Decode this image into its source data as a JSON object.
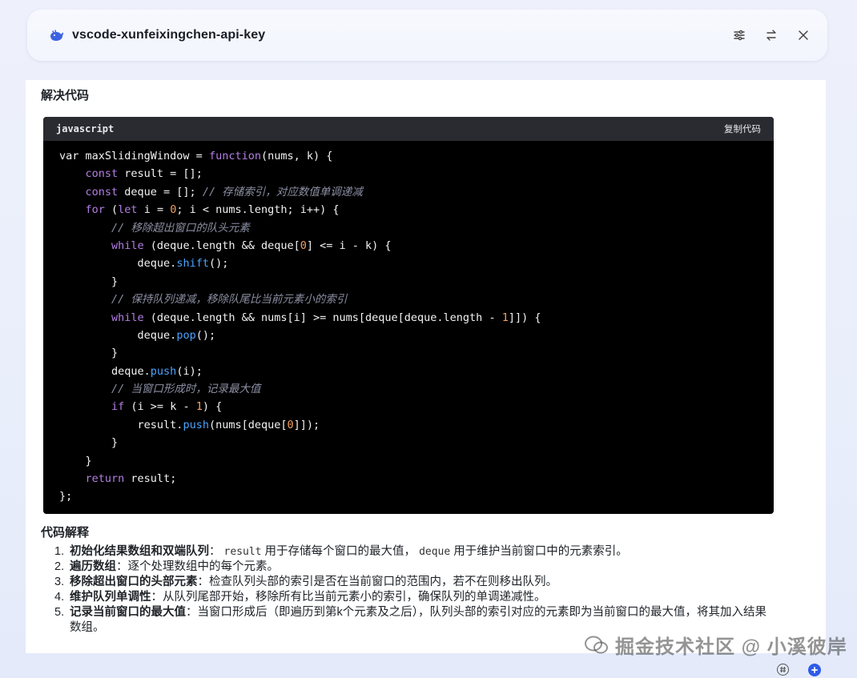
{
  "window": {
    "title": "vscode-xunfeixingchen-api-key",
    "icons": [
      "whale-logo-icon",
      "settings-sliders-icon",
      "swap-icon",
      "close-icon"
    ]
  },
  "section1": {
    "heading": "解决代码"
  },
  "code": {
    "language": "javascript",
    "copy_label": "复制代码",
    "lines": [
      [
        [
          "",
          "var maxSlidingWindow = "
        ],
        [
          "kw",
          "function"
        ],
        [
          "",
          "(nums, k) {"
        ]
      ],
      [
        [
          "",
          "    "
        ],
        [
          "kw",
          "const"
        ],
        [
          "",
          " result = [];"
        ]
      ],
      [
        [
          "",
          "    "
        ],
        [
          "kw",
          "const"
        ],
        [
          "",
          " deque = []; "
        ],
        [
          "cm",
          "// 存储索引，对应数值单调递减"
        ]
      ],
      [
        [
          "",
          "    "
        ],
        [
          "kw",
          "for"
        ],
        [
          "",
          " ("
        ],
        [
          "kw",
          "let"
        ],
        [
          "",
          " i = "
        ],
        [
          "num",
          "0"
        ],
        [
          "",
          "; i < nums.length; i++) {"
        ]
      ],
      [
        [
          "",
          "        "
        ],
        [
          "cm",
          "// 移除超出窗口的队头元素"
        ]
      ],
      [
        [
          "",
          "        "
        ],
        [
          "kw",
          "while"
        ],
        [
          "",
          " (deque.length && deque["
        ],
        [
          "num",
          "0"
        ],
        [
          "",
          "] <= i - k) {"
        ]
      ],
      [
        [
          "",
          "            deque."
        ],
        [
          "fn",
          "shift"
        ],
        [
          "",
          "();"
        ]
      ],
      [
        [
          "",
          "        }"
        ]
      ],
      [
        [
          "",
          "        "
        ],
        [
          "cm",
          "// 保持队列递减，移除队尾比当前元素小的索引"
        ]
      ],
      [
        [
          "",
          "        "
        ],
        [
          "kw",
          "while"
        ],
        [
          "",
          " (deque.length && nums[i] >= nums[deque[deque.length - "
        ],
        [
          "num",
          "1"
        ],
        [
          "",
          "]]) {"
        ]
      ],
      [
        [
          "",
          "            deque."
        ],
        [
          "fn",
          "pop"
        ],
        [
          "",
          "();"
        ]
      ],
      [
        [
          "",
          "        }"
        ]
      ],
      [
        [
          "",
          "        deque."
        ],
        [
          "fn",
          "push"
        ],
        [
          "",
          "(i);"
        ]
      ],
      [
        [
          "",
          "        "
        ],
        [
          "cm",
          "// 当窗口形成时，记录最大值"
        ]
      ],
      [
        [
          "",
          "        "
        ],
        [
          "kw",
          "if"
        ],
        [
          "",
          " (i >= k - "
        ],
        [
          "num",
          "1"
        ],
        [
          "",
          ") {"
        ]
      ],
      [
        [
          "",
          "            result."
        ],
        [
          "fn",
          "push"
        ],
        [
          "",
          "(nums[deque["
        ],
        [
          "num",
          "0"
        ],
        [
          "",
          "]]);"
        ]
      ],
      [
        [
          "",
          "        }"
        ]
      ],
      [
        [
          "",
          "    }"
        ]
      ],
      [
        [
          "",
          "    "
        ],
        [
          "kw",
          "return"
        ],
        [
          "",
          " result;"
        ]
      ],
      [
        [
          "",
          "};"
        ]
      ]
    ]
  },
  "section2": {
    "heading": "代码解释"
  },
  "explanation": [
    {
      "num": "1.",
      "parts": [
        [
          "b",
          "初始化结果数组和双端队列"
        ],
        [
          "",
          "： "
        ],
        [
          "code",
          "result"
        ],
        [
          "",
          " 用于存储每个窗口的最大值， "
        ],
        [
          "code",
          "deque"
        ],
        [
          "",
          " 用于维护当前窗口中的元素索引。"
        ]
      ]
    },
    {
      "num": "2.",
      "parts": [
        [
          "b",
          "遍历数组"
        ],
        [
          "",
          "：逐个处理数组中的每个元素。"
        ]
      ]
    },
    {
      "num": "3.",
      "parts": [
        [
          "b",
          "移除超出窗口的头部元素"
        ],
        [
          "",
          "：检查队列头部的索引是否在当前窗口的范围内，若不在则移出队列。"
        ]
      ]
    },
    {
      "num": "4.",
      "parts": [
        [
          "b",
          "维护队列单调性"
        ],
        [
          "",
          "：从队列尾部开始，移除所有比当前元素小的索引，确保队列的单调递减性。"
        ]
      ]
    },
    {
      "num": "5.",
      "parts": [
        [
          "b",
          "记录当前窗口的最大值"
        ],
        [
          "",
          "：当窗口形成后（即遍历到第k个元素及之后），队列头部的索引对应的元素即为当前窗口的最大值，将其加入结果数组。"
        ]
      ]
    }
  ],
  "watermark": {
    "text": "掘金技术社区 @ 小溪彼岸"
  },
  "footer_icons": [
    "hash-icon",
    "add-circle-icon"
  ],
  "colors": {
    "code_bg": "#000000",
    "code_header_bg": "#2a2b30",
    "keyword": "#b37fe4",
    "function": "#4aa3ff",
    "number": "#f2a062",
    "comment": "#8b8fa3",
    "accent_blue": "#2f5be8"
  }
}
